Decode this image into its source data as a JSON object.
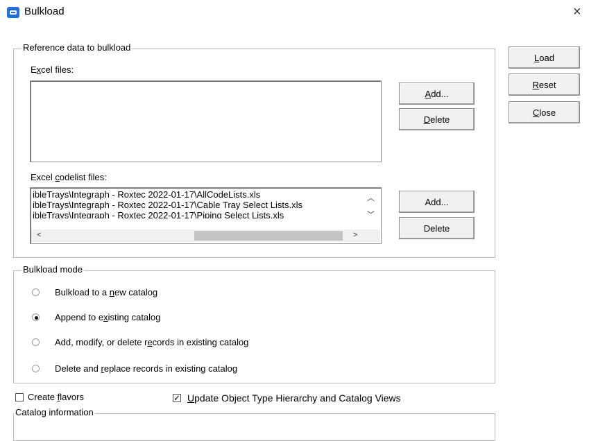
{
  "window": {
    "title": "Bulkload",
    "close_glyph": "×",
    "icon": "bulkload-app-icon"
  },
  "actions": {
    "load": {
      "mn": "L",
      "rest": "oad"
    },
    "reset": {
      "mn": "R",
      "rest": "eset"
    },
    "close": {
      "mn": "C",
      "rest": "lose"
    }
  },
  "reference": {
    "group_label": "Reference data to bulkload",
    "excel_files": {
      "pre": "E",
      "mn": "x",
      "post": "cel files:",
      "items": []
    },
    "excel_add": {
      "mn": "A",
      "rest": "dd..."
    },
    "excel_delete": {
      "mn": "D",
      "rest": "elete"
    },
    "codelist": {
      "pre": "Excel ",
      "mn": "c",
      "post": "odelist files:",
      "items": [
        "ibleTrays\\Integraph - Roxtec 2022-01-17\\AllCodeLists.xls",
        "ibleTrays\\Integraph - Roxtec 2022-01-17\\Cable Tray Select Lists.xls",
        "ibleTrays\\Integraph - Roxtec 2022-01-17\\Piping Select Lists.xls"
      ]
    },
    "codelist_add": "Add...",
    "codelist_delete": "Delete"
  },
  "mode": {
    "group_label": "Bulkload mode",
    "options": [
      {
        "pre": "Bulkload to a ",
        "mn": "n",
        "post": "ew catalog",
        "selected": false
      },
      {
        "pre": "Append to e",
        "mn": "x",
        "post": "isting  catalog",
        "selected": true
      },
      {
        "pre": "Add, modify, or delete r",
        "mn": "e",
        "post": "cords in existing catalog",
        "selected": false
      },
      {
        "pre": "Delete and ",
        "mn": "r",
        "post": "eplace records in existing catalog",
        "selected": false
      }
    ]
  },
  "options": {
    "create_flavors": {
      "pre": "Create ",
      "mn": "f",
      "post": "lavors",
      "checked": false
    },
    "update_hierarchy": {
      "mn": "U",
      "post": "pdate Object Type Hierarchy and Catalog Views",
      "checked": true,
      "check_glyph": "✓"
    }
  },
  "catalog_info": {
    "group_label": "Catalog information"
  }
}
